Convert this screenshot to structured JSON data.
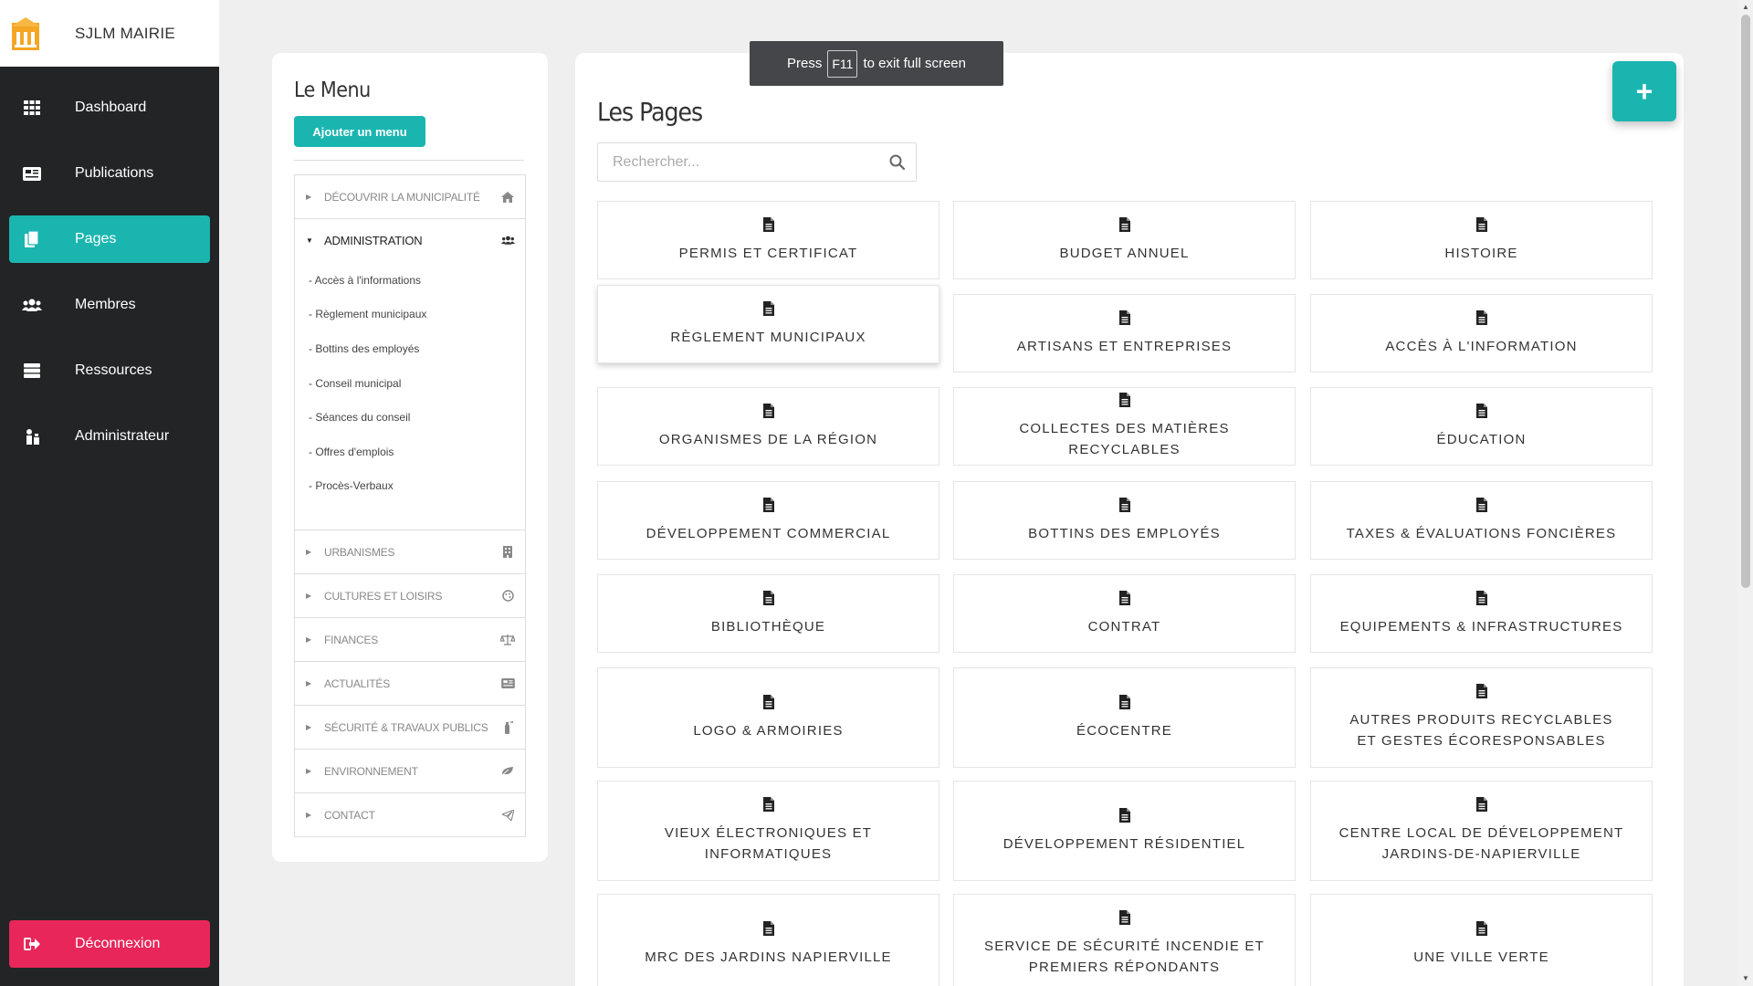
{
  "brand": {
    "name": "SJLM MAIRIE"
  },
  "sidebar": {
    "items": [
      {
        "label": "Dashboard",
        "icon": "grid-icon"
      },
      {
        "label": "Publications",
        "icon": "newspaper-icon"
      },
      {
        "label": "Pages",
        "icon": "copy-icon",
        "active": true
      },
      {
        "label": "Membres",
        "icon": "users-icon"
      },
      {
        "label": "Ressources",
        "icon": "server-icon"
      },
      {
        "label": "Administrateur",
        "icon": "admin-icon"
      }
    ],
    "logout": "Déconnexion"
  },
  "menu": {
    "title": "Le Menu",
    "add_button": "Ajouter un menu",
    "items": [
      {
        "label": "DÉCOUVRIR LA MUNICIPALITÉ",
        "icon": "home-icon"
      },
      {
        "label": "ADMINISTRATION",
        "icon": "users-icon",
        "open": true,
        "children": [
          "- Accès à l'informations",
          "- Règlement municipaux",
          "- Bottins des employés",
          "- Conseil municipal",
          "- Séances du conseil",
          "- Offres d'emplois",
          "- Procès-Verbaux"
        ]
      },
      {
        "label": "URBANISMES",
        "icon": "building-icon"
      },
      {
        "label": "CULTURES ET LOISIRS",
        "icon": "palette-icon"
      },
      {
        "label": "FINANCES",
        "icon": "balance-icon"
      },
      {
        "label": "ACTUALITÉS",
        "icon": "newspaper-icon"
      },
      {
        "label": "SÉCURITÉ & TRAVAUX PUBLICS",
        "icon": "extinguisher-icon"
      },
      {
        "label": "ENVIRONNEMENT",
        "icon": "leaf-icon"
      },
      {
        "label": "CONTACT",
        "icon": "paper-plane-icon"
      }
    ]
  },
  "pages": {
    "title": "Les Pages",
    "search_placeholder": "Rechercher...",
    "add_button": "+",
    "cards": [
      "PERMIS ET CERTIFICAT",
      "BUDGET ANNUEL",
      "HISTOIRE",
      "RÈGLEMENT MUNICIPAUX",
      "ARTISANS ET ENTREPRISES",
      "ACCÈS À L'INFORMATION",
      "ORGANISMES DE LA RÉGION",
      "COLLECTES DES MATIÈRES RECYCLABLES",
      "ÉDUCATION",
      "DÉVELOPPEMENT COMMERCIAL",
      "BOTTINS DES EMPLOYÉS",
      "TAXES & ÉVALUATIONS FONCIÈRES",
      "BIBLIOTHÈQUE",
      "CONTRAT",
      "EQUIPEMENTS & INFRASTRUCTURES",
      "LOGO & ARMOIRIES",
      "ÉCOCENTRE",
      "AUTRES PRODUITS RECYCLABLES ET GESTES ÉCORESPONSABLES",
      "VIEUX ÉLECTRONIQUES ET INFORMATIQUES",
      "DÉVELOPPEMENT RÉSIDENTIEL",
      "CENTRE LOCAL DE DÉVELOPPEMENT JARDINS-DE-NAPIERVILLE",
      "MRC DES JARDINS NAPIERVILLE",
      "SERVICE DE SÉCURITÉ INCENDIE ET PREMIERS RÉPONDANTS",
      "UNE VILLE VERTE"
    ]
  },
  "toast": {
    "press": "Press",
    "key": "F11",
    "rest": "to exit full screen"
  },
  "colors": {
    "accent": "#1bb5b0",
    "danger": "#e8265a",
    "sidebar": "#222426"
  }
}
